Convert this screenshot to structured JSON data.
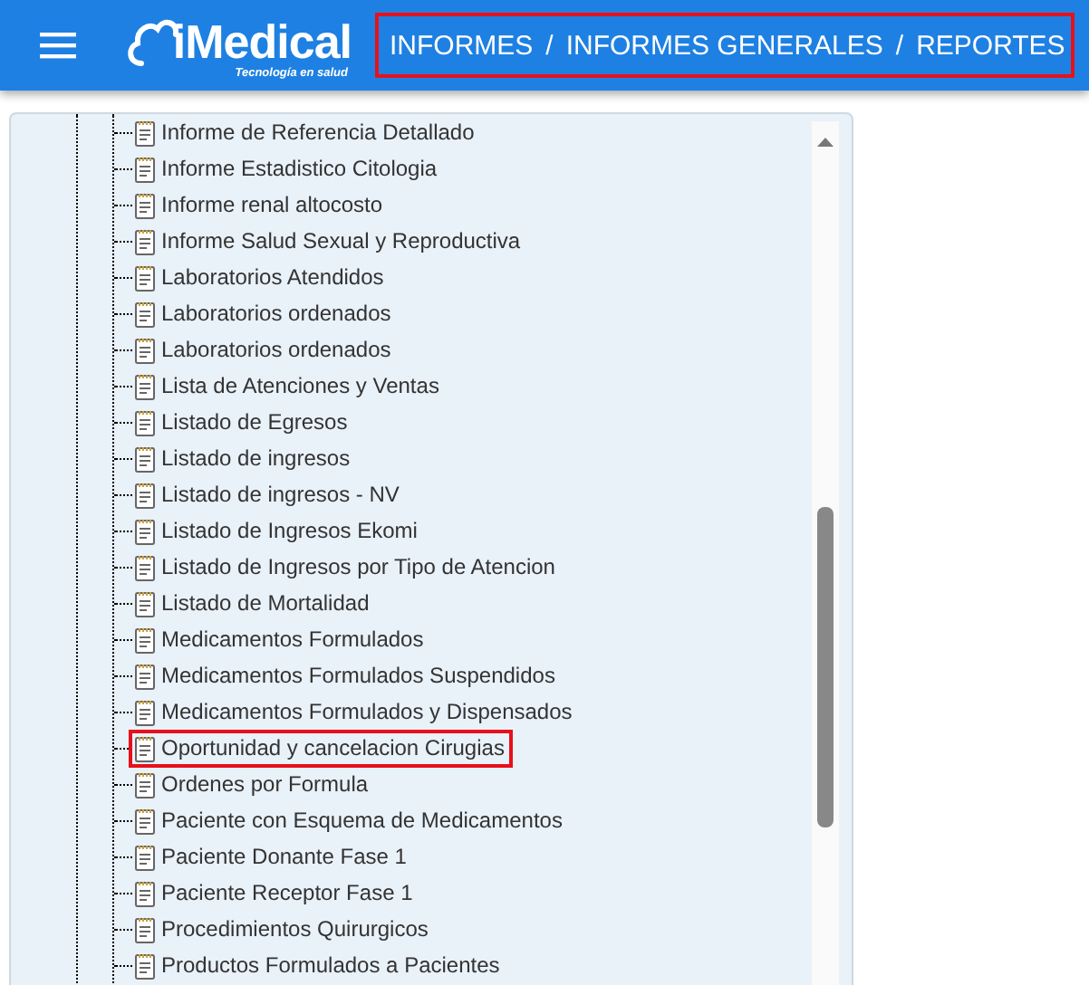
{
  "header": {
    "logo": {
      "name": "iMedical",
      "tagline": "Tecnología en salud"
    },
    "breadcrumb": {
      "highlighted": true,
      "parts": [
        "INFORMES",
        "/",
        "INFORMES GENERALES",
        "/",
        "REPORTES"
      ]
    }
  },
  "tree": {
    "items": [
      {
        "label": "Informe de Referencia Detallado",
        "highlighted": false
      },
      {
        "label": "Informe Estadistico Citologia",
        "highlighted": false
      },
      {
        "label": "Informe renal altocosto",
        "highlighted": false
      },
      {
        "label": "Informe Salud Sexual y Reproductiva",
        "highlighted": false
      },
      {
        "label": "Laboratorios Atendidos",
        "highlighted": false
      },
      {
        "label": "Laboratorios ordenados",
        "highlighted": false
      },
      {
        "label": "Laboratorios ordenados",
        "highlighted": false
      },
      {
        "label": "Lista de Atenciones y Ventas",
        "highlighted": false
      },
      {
        "label": "Listado de Egresos",
        "highlighted": false
      },
      {
        "label": "Listado de ingresos",
        "highlighted": false
      },
      {
        "label": "Listado de ingresos - NV",
        "highlighted": false
      },
      {
        "label": "Listado de Ingresos Ekomi",
        "highlighted": false
      },
      {
        "label": "Listado de Ingresos por Tipo de Atencion",
        "highlighted": false
      },
      {
        "label": "Listado de Mortalidad",
        "highlighted": false
      },
      {
        "label": "Medicamentos Formulados",
        "highlighted": false
      },
      {
        "label": "Medicamentos Formulados Suspendidos",
        "highlighted": false
      },
      {
        "label": "Medicamentos Formulados y Dispensados",
        "highlighted": false
      },
      {
        "label": "Oportunidad y cancelacion Cirugias",
        "highlighted": true
      },
      {
        "label": "Ordenes por Formula",
        "highlighted": false
      },
      {
        "label": "Paciente con Esquema de Medicamentos",
        "highlighted": false
      },
      {
        "label": "Paciente Donante Fase 1",
        "highlighted": false
      },
      {
        "label": "Paciente Receptor Fase 1",
        "highlighted": false
      },
      {
        "label": "Procedimientos Quirurgicos",
        "highlighted": false
      },
      {
        "label": "Productos Formulados a Pacientes",
        "highlighted": false
      }
    ]
  }
}
